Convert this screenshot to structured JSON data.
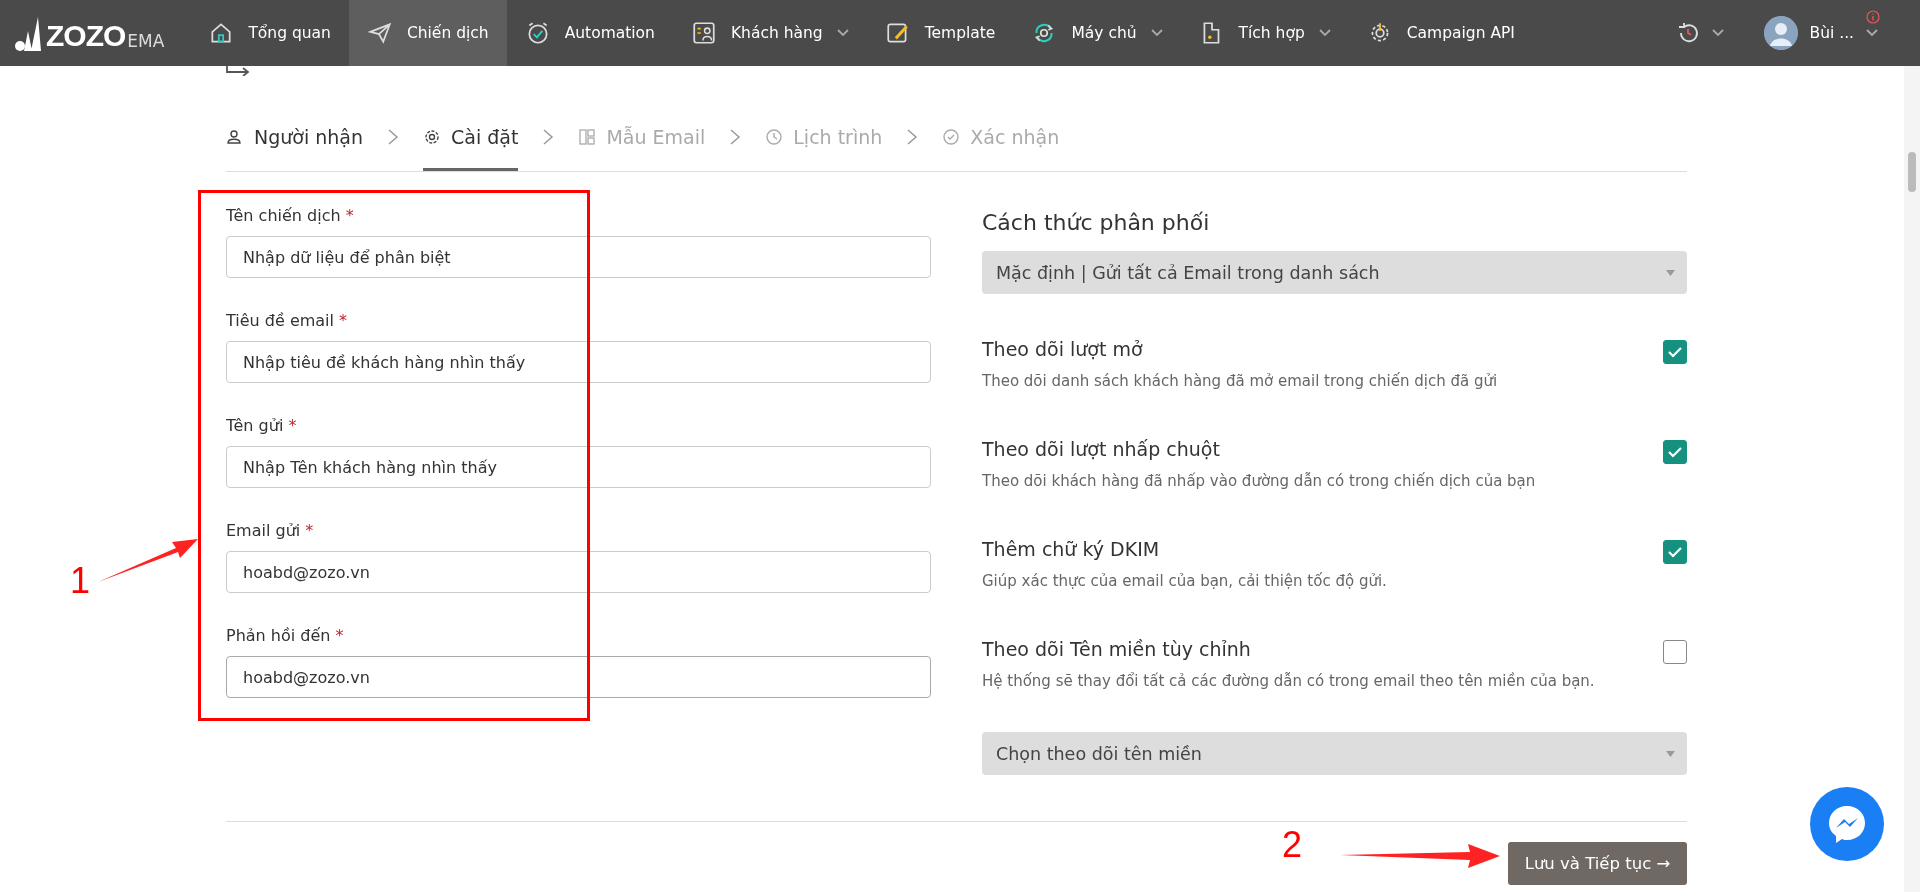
{
  "nav": {
    "logo": {
      "main": "ZOZO",
      "sub": "EMA"
    },
    "items": [
      {
        "label": "Tổng quan",
        "selected": false,
        "dropdown": false
      },
      {
        "label": "Chiến dịch",
        "selected": true,
        "dropdown": false
      },
      {
        "label": "Automation",
        "selected": false,
        "dropdown": false
      },
      {
        "label": "Khách hàng",
        "selected": false,
        "dropdown": true
      },
      {
        "label": "Template",
        "selected": false,
        "dropdown": false
      },
      {
        "label": "Máy chủ",
        "selected": false,
        "dropdown": true
      },
      {
        "label": "Tích hợp",
        "selected": false,
        "dropdown": true
      },
      {
        "label": "Campaign API",
        "selected": false,
        "dropdown": false
      }
    ],
    "user": {
      "name": "Bùi ..."
    }
  },
  "steps": [
    {
      "label": "Người nhận",
      "selected": false,
      "disabled": false
    },
    {
      "label": "Cài đặt",
      "selected": true,
      "disabled": false
    },
    {
      "label": "Mẫu Email",
      "selected": false,
      "disabled": true
    },
    {
      "label": "Lịch trình",
      "selected": false,
      "disabled": true
    },
    {
      "label": "Xác nhận",
      "selected": false,
      "disabled": true
    }
  ],
  "fields": [
    {
      "label": "Tên chiến dịch",
      "required_mark": "*",
      "value": "Nhập dữ liệu để phân biệt",
      "focused": false
    },
    {
      "label": "Tiêu đề email",
      "required_mark": "*",
      "value": "Nhập tiêu đề khách hàng nhìn thấy",
      "focused": false
    },
    {
      "label": "Tên gửi",
      "required_mark": "*",
      "value": "Nhập Tên khách hàng nhìn thấy",
      "focused": false
    },
    {
      "label": "Email gửi",
      "required_mark": "*",
      "value": "hoabd@zozo.vn",
      "focused": false
    },
    {
      "label": "Phản hồi đến",
      "required_mark": "*",
      "value": "hoabd@zozo.vn",
      "focused": true
    }
  ],
  "distribution": {
    "title": "Cách thức phân phối",
    "select": "Mặc định | Gửi tất cả Email trong danh sách"
  },
  "options": [
    {
      "title": "Theo dõi lượt mở",
      "description": "Theo dõi danh sách khách hàng đã mở email trong chiến dịch đã gửi",
      "checked": true
    },
    {
      "title": "Theo dõi lượt nhấp chuột",
      "description": "Theo dõi khách hàng đã nhấp vào đường dẫn có trong chiến dịch của bạn",
      "checked": true
    },
    {
      "title": "Thêm chữ ký DKIM",
      "description": "Giúp xác thực của email của bạn, cải thiện tốc độ gửi.",
      "checked": true
    },
    {
      "title": "Theo dõi Tên miền tùy chỉnh",
      "description": "Hệ thống sẽ thay đổi tất cả các đường dẫn có trong email theo tên miền của bạn.",
      "checked": false
    }
  ],
  "domain_select": "Chọn theo dõi tên miền",
  "submit": "Lưu và Tiếp tục →",
  "annotations": [
    {
      "label": "1"
    },
    {
      "label": "2"
    }
  ]
}
